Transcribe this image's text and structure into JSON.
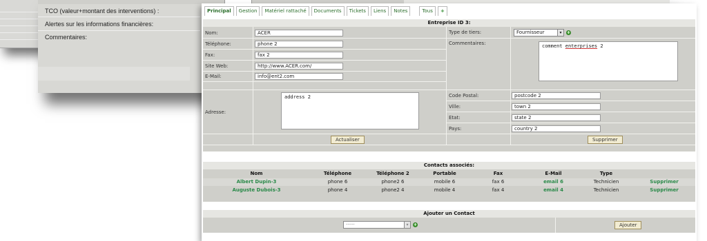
{
  "background": {
    "labels": [
      "TCO (valeur+montant des interventions) :",
      "Alertes sur les informations financières:",
      "Commentaires:"
    ]
  },
  "tabs": [
    {
      "label": "Principal",
      "active": true
    },
    {
      "label": "Gestion"
    },
    {
      "label": "Matériel rattaché"
    },
    {
      "label": "Documents"
    },
    {
      "label": "Tickets"
    },
    {
      "label": "Liens"
    },
    {
      "label": "Notes"
    },
    {
      "label": "Tous"
    },
    {
      "label": "+"
    }
  ],
  "enterprise": {
    "title": "Entreprise ID 3:",
    "fields": {
      "name_label": "Nom:",
      "name_value": "ACER",
      "phone_label": "Téléphone:",
      "phone_value": "phone 2",
      "fax_label": "Fax:",
      "fax_value": "fax 2",
      "web_label": "Site Web:",
      "web_value": "http://www.ACER.com/",
      "email_label": "E-Mail:",
      "email_value": "info@ent2.com",
      "address_label": "Adresse:",
      "address_value": "address 2",
      "type_label": "Type de tiers:",
      "type_value": "Fournisseur",
      "comments_label": "Commentaires:",
      "comments_word1": "comment",
      "comments_word2": "enterprises",
      "comments_word3": "2",
      "postcode_label": "Code Postal:",
      "postcode_value": "postcode 2",
      "town_label": "Ville:",
      "town_value": "town 2",
      "state_label": "Etat:",
      "state_value": "state 2",
      "country_label": "Pays:",
      "country_value": "country 2"
    },
    "update_button": "Actualiser",
    "delete_button": "Supprimer"
  },
  "contacts": {
    "title": "Contacts associés:",
    "columns": [
      "Nom",
      "Téléphone",
      "Téléphone 2",
      "Portable",
      "Fax",
      "E-Mail",
      "Type",
      ""
    ],
    "rows": [
      {
        "name": "Albert Dupin-3",
        "phone": "phone 6",
        "phone2": "phone2 6",
        "mobile": "mobile 6",
        "fax": "fax 6",
        "email": "email 6",
        "type": "Technicien",
        "action": "Supprimer"
      },
      {
        "name": "Auguste Dubois-3",
        "phone": "phone 4",
        "phone2": "phone2 4",
        "mobile": "mobile 4",
        "fax": "fax 4",
        "email": "email 4",
        "type": "Technicien",
        "action": "Supprimer"
      }
    ]
  },
  "add_contact": {
    "title": "Ajouter un Contact",
    "select_value": "-----",
    "button": "Ajouter"
  },
  "colors": {
    "link_green": "#2b8a4a",
    "panel_bg": "#cfcfca",
    "button_bg": "#f2ecd2"
  }
}
